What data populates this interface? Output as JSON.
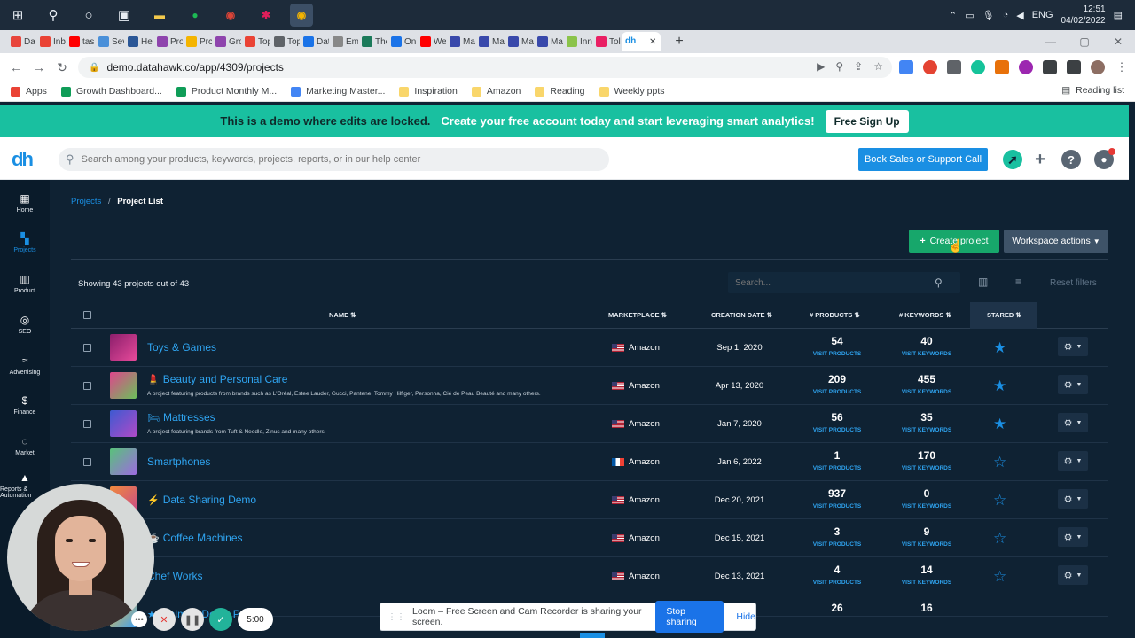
{
  "taskbar": {
    "apps": [
      {
        "icon": "file-explorer-icon",
        "color": "#f2c94c",
        "glyph": "▬"
      },
      {
        "icon": "spotify-icon",
        "color": "#1db954",
        "glyph": "●"
      },
      {
        "icon": "chrome-icon",
        "color": "#db4437",
        "glyph": "◉"
      },
      {
        "icon": "slack-icon",
        "color": "#e01e5a",
        "glyph": "✱"
      },
      {
        "icon": "chrome-active-icon",
        "color": "#f4b400",
        "glyph": "◉"
      }
    ],
    "lang": "ENG",
    "time": "12:51",
    "date": "04/02/2022"
  },
  "tabs": [
    {
      "label": "Da",
      "color": "#e8453c"
    },
    {
      "label": "Inb",
      "color": "#ea4335"
    },
    {
      "label": "tasl",
      "color": "#ff0000"
    },
    {
      "label": "Sev",
      "color": "#4a90d9"
    },
    {
      "label": "Hel",
      "color": "#2b5797"
    },
    {
      "label": "Pro",
      "color": "#8e44ad"
    },
    {
      "label": "Prc",
      "color": "#f4b400"
    },
    {
      "label": "Gro",
      "color": "#8e44ad"
    },
    {
      "label": "Top",
      "color": "#ea4335"
    },
    {
      "label": "Top",
      "color": "#5f6368"
    },
    {
      "label": "Dat",
      "color": "#1a73e8"
    },
    {
      "label": "Em",
      "color": "#888888"
    },
    {
      "label": "The",
      "color": "#1b7a5a"
    },
    {
      "label": "On",
      "color": "#1a73e8"
    },
    {
      "label": "We",
      "color": "#ff0000"
    },
    {
      "label": "Ma",
      "color": "#3949ab"
    },
    {
      "label": "Ma",
      "color": "#3949ab"
    },
    {
      "label": "Ma",
      "color": "#3949ab"
    },
    {
      "label": "Ma",
      "color": "#3949ab"
    },
    {
      "label": "Inn",
      "color": "#8bc34a"
    },
    {
      "label": "Tol",
      "color": "#e91e63"
    }
  ],
  "active_tab": {
    "label": "dh",
    "close": "✕"
  },
  "address": {
    "url": "demo.datahawk.co/app/4309/projects"
  },
  "bookmarks": [
    {
      "label": "Apps",
      "color": "#ea4335"
    },
    {
      "label": "Growth Dashboard...",
      "color": "#0f9d58"
    },
    {
      "label": "Product Monthly M...",
      "color": "#0f9d58"
    },
    {
      "label": "Marketing Master...",
      "color": "#4285f4"
    },
    {
      "label": "Inspiration",
      "color": "#f9d66b"
    },
    {
      "label": "Amazon",
      "color": "#f9d66b"
    },
    {
      "label": "Reading",
      "color": "#f9d66b"
    },
    {
      "label": "Weekly ppts",
      "color": "#f9d66b"
    }
  ],
  "reading_list": "Reading list",
  "banner": {
    "text1": "This is a demo where edits are locked.",
    "text2": "Create your free account today and start leveraging smart analytics!",
    "button": "Free Sign Up"
  },
  "header": {
    "logo": "dh",
    "search_placeholder": "Search among your products, keywords, projects, reports, or in our help center",
    "book_button": "Book Sales or Support Call"
  },
  "sidebar": [
    {
      "label": "Home",
      "icon": "home-icon",
      "glyph": "▦"
    },
    {
      "label": "Projects",
      "icon": "projects-icon",
      "glyph": "▚",
      "active": true
    },
    {
      "label": "Product",
      "icon": "product-icon",
      "glyph": "▥"
    },
    {
      "label": "SEO",
      "icon": "seo-icon",
      "glyph": "◎"
    },
    {
      "label": "Advertising",
      "icon": "advertising-icon",
      "glyph": "≈"
    },
    {
      "label": "Finance",
      "icon": "finance-icon",
      "glyph": "$"
    },
    {
      "label": "Market",
      "icon": "market-icon",
      "glyph": "◌"
    },
    {
      "label": "Reports & Automation",
      "icon": "reports-icon",
      "glyph": "▲"
    }
  ],
  "breadcrumb": {
    "parent": "Projects",
    "current": "Project List"
  },
  "actions": {
    "create": "Create project",
    "workspace": "Workspace actions"
  },
  "table_toolbar": {
    "showing": "Showing 43 projects out of 43",
    "search_placeholder": "Search...",
    "reset": "Reset filters"
  },
  "columns": {
    "name": "NAME ⇅",
    "marketplace": "MARKETPLACE ⇅",
    "creation_date": "CREATION DATE ⇅",
    "products": "# PRODUCTS ⇅",
    "keywords": "# KEYWORDS ⇅",
    "stared": "STARED ⇅"
  },
  "visit_products": "VISIT PRODUCTS",
  "visit_keywords": "VISIT KEYWORDS",
  "rows": [
    {
      "name": "Toys & Games",
      "emoji": "",
      "desc": "",
      "marketplace": "Amazon",
      "flag": "us",
      "date": "Sep 1, 2020",
      "products": "54",
      "keywords": "40",
      "starred": true,
      "thumb": [
        "#8b1e6b",
        "#e64a9a"
      ]
    },
    {
      "name": "Beauty and Personal Care",
      "emoji": "💄",
      "desc": "A project featuring products from brands such as L'Oréal, Estee Lauder, Gucci, Pantene, Tommy Hilfiger, Personna, Cié de Peau Beauté and many others.",
      "marketplace": "Amazon",
      "flag": "us",
      "date": "Apr 13, 2020",
      "products": "209",
      "keywords": "455",
      "starred": true,
      "thumb": [
        "#e0458c",
        "#6ac15a"
      ]
    },
    {
      "name": "Mattresses",
      "emoji": "🛏",
      "desc": "A project featuring brands from Tuft & Needle, Zinus and many others.",
      "marketplace": "Amazon",
      "flag": "us",
      "date": "Jan 7, 2020",
      "products": "56",
      "keywords": "35",
      "starred": true,
      "thumb": [
        "#3d5ad1",
        "#b04ac8"
      ]
    },
    {
      "name": "Smartphones",
      "emoji": "",
      "desc": "",
      "marketplace": "Amazon",
      "flag": "fr",
      "date": "Jan 6, 2022",
      "products": "1",
      "keywords": "170",
      "starred": false,
      "thumb": [
        "#58c27a",
        "#9d6be0"
      ]
    },
    {
      "name": "Data Sharing Demo",
      "emoji": "⚡",
      "desc": "",
      "marketplace": "Amazon",
      "flag": "us",
      "date": "Dec 20, 2021",
      "products": "937",
      "keywords": "0",
      "starred": false,
      "thumb": [
        "#f08a3c",
        "#c94a8a"
      ]
    },
    {
      "name": "Coffee Machines",
      "emoji": "☕",
      "desc": "",
      "marketplace": "Amazon",
      "flag": "us",
      "date": "Dec 15, 2021",
      "products": "3",
      "keywords": "9",
      "starred": false,
      "thumb": [
        "#d9a14a",
        "#5a8fd0"
      ]
    },
    {
      "name": "Chef Works",
      "emoji": "",
      "desc": "",
      "marketplace": "Amazon",
      "flag": "us",
      "date": "Dec 13, 2021",
      "products": "4",
      "keywords": "14",
      "starred": false,
      "thumb": [
        "#4ab0d9",
        "#d94a6a"
      ]
    },
    {
      "name": "Walmart Demo Project",
      "emoji": "★",
      "desc": "",
      "marketplace": "",
      "flag": "",
      "date": "",
      "products": "26",
      "keywords": "16",
      "starred": false,
      "thumb": [
        "#f0c040",
        "#40a0f0"
      ]
    }
  ],
  "loom": {
    "text": "Loom – Free Screen and Cam Recorder is sharing your screen.",
    "stop": "Stop sharing",
    "hide": "Hide"
  },
  "recorder": {
    "timer": "5:00"
  },
  "colors": {
    "accent": "#1a8fe3",
    "banner": "#19c0a0",
    "create": "#17a76b",
    "background": "#0f2233"
  }
}
